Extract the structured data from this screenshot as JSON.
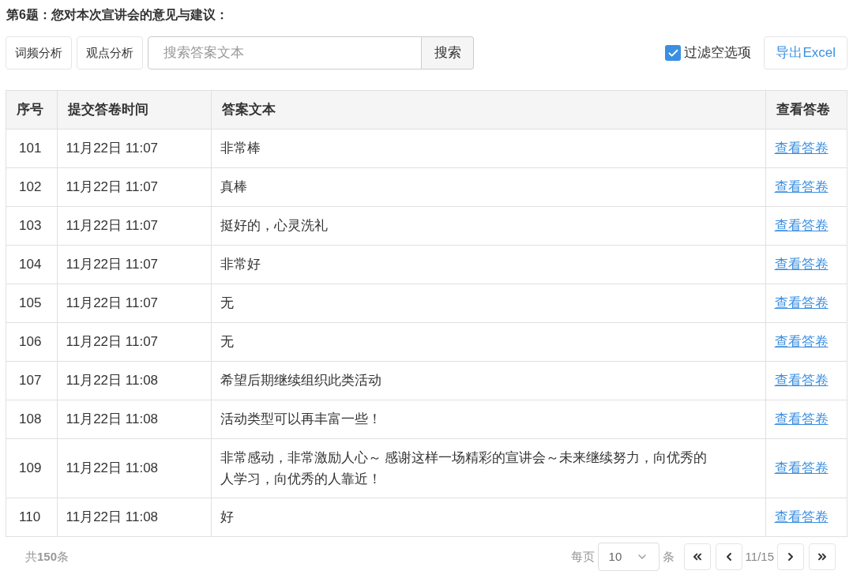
{
  "question_title": "第6题：您对本次宣讲会的意见与建议：",
  "toolbar": {
    "buttons": [
      "词频分析",
      "观点分析"
    ],
    "search": {
      "placeholder": "搜索答案文本",
      "button": "搜索"
    },
    "filter": {
      "label": "过滤空选项",
      "checked": true
    },
    "export": "导出Excel"
  },
  "table": {
    "columns": [
      "序号",
      "提交答卷时间",
      "答案文本",
      "查看答卷"
    ],
    "rows": [
      {
        "no": "101",
        "time": "11月22日 11:07",
        "answer": "非常棒",
        "link": "查看答卷"
      },
      {
        "no": "102",
        "time": "11月22日 11:07",
        "answer": "真棒",
        "link": "查看答卷"
      },
      {
        "no": "103",
        "time": "11月22日 11:07",
        "answer": "挺好的，心灵洗礼",
        "link": "查看答卷"
      },
      {
        "no": "104",
        "time": "11月22日 11:07",
        "answer": "非常好",
        "link": "查看答卷"
      },
      {
        "no": "105",
        "time": "11月22日 11:07",
        "answer": "无",
        "link": "查看答卷"
      },
      {
        "no": "106",
        "time": "11月22日 11:07",
        "answer": "无",
        "link": "查看答卷"
      },
      {
        "no": "107",
        "time": "11月22日 11:08",
        "answer": "希望后期继续组织此类活动",
        "link": "查看答卷"
      },
      {
        "no": "108",
        "time": "11月22日 11:08",
        "answer": "活动类型可以再丰富一些！",
        "link": "查看答卷"
      },
      {
        "no": "109",
        "time": "11月22日 11:08",
        "answer": "非常感动，非常激励人心～ 感谢这样一场精彩的宣讲会～未来继续努力，向优秀的人学习，向优秀的人靠近！",
        "link": "查看答卷"
      },
      {
        "no": "110",
        "time": "11月22日 11:08",
        "answer": "好",
        "link": "查看答卷"
      }
    ]
  },
  "footer": {
    "total": "共**150**条",
    "per_page_label": "每页",
    "per_page": "10",
    "per_page_unit": "条",
    "page": "11/15"
  }
}
